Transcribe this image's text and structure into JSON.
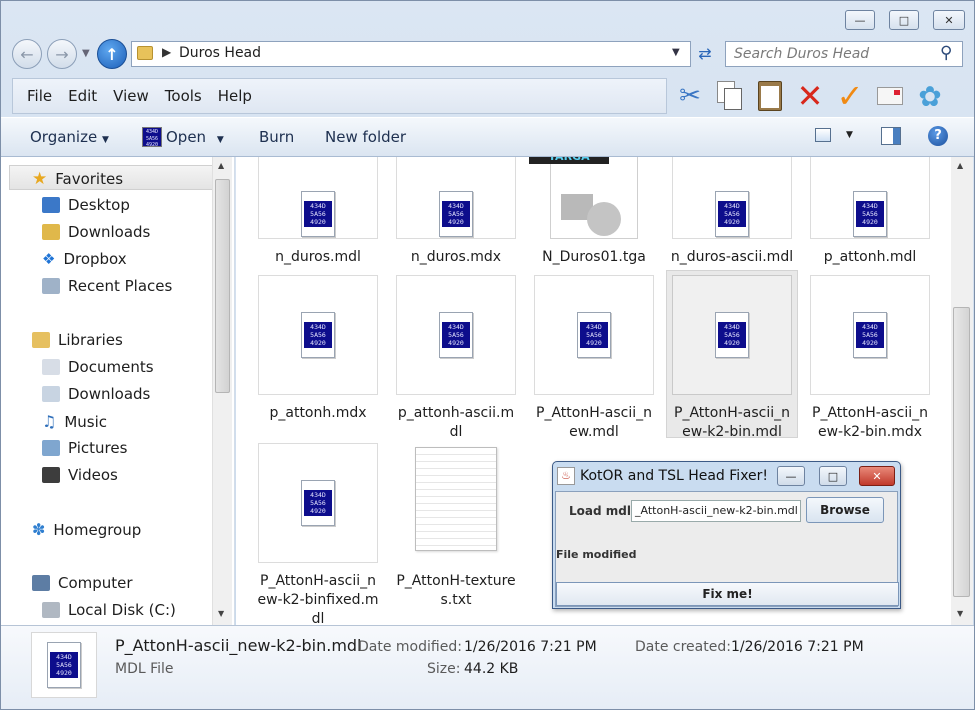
{
  "window": {
    "address_path": "Duros Head",
    "search_placeholder": "Search Duros Head",
    "caption_minimize": "—",
    "caption_maximize": "□",
    "caption_close": "✕"
  },
  "menu": [
    "File",
    "Edit",
    "View",
    "Tools",
    "Help"
  ],
  "toolbar_icons": [
    "scissors-icon",
    "copy-icon",
    "paste-icon",
    "delete-icon",
    "check-icon",
    "mail-icon",
    "shell-icon"
  ],
  "commandbar": {
    "organize": "Organize",
    "open": "Open",
    "burn": "Burn",
    "new_folder": "New folder"
  },
  "nav": {
    "favorites": "Favorites",
    "desktop": "Desktop",
    "downloads": "Downloads",
    "dropbox": "Dropbox",
    "recent": "Recent Places",
    "libraries": "Libraries",
    "documents": "Documents",
    "lib_downloads": "Downloads",
    "music": "Music",
    "pictures": "Pictures",
    "videos": "Videos",
    "homegroup": "Homegroup",
    "computer": "Computer",
    "local_disk": "Local Disk (C:)"
  },
  "files": [
    {
      "name": "n_duros.mdl",
      "type": "mdl"
    },
    {
      "name": "n_duros.mdx",
      "type": "mdl"
    },
    {
      "name": "N_Duros01.tga",
      "type": "tga"
    },
    {
      "name": "n_duros-ascii.mdl",
      "type": "mdl"
    },
    {
      "name": "p_attonh.mdl",
      "type": "mdl"
    },
    {
      "name": "p_attonh.mdx",
      "type": "mdl"
    },
    {
      "name": "p_attonh-ascii.mdl",
      "type": "mdl"
    },
    {
      "name": "P_AttonH-ascii_new.mdl",
      "type": "mdl"
    },
    {
      "name": "P_AttonH-ascii_new-k2-bin.mdl",
      "type": "mdl",
      "selected": true
    },
    {
      "name": "P_AttonH-ascii_new-k2-bin.mdx",
      "type": "mdl"
    },
    {
      "name": "P_AttonH-ascii_new-k2-binfixed.mdl",
      "type": "mdl"
    },
    {
      "name": "P_AttonH-textures.txt",
      "type": "txt"
    }
  ],
  "file_label_lines": [
    [
      "n_duros.mdl"
    ],
    [
      "n_duros.mdx"
    ],
    [
      "N_Duros01.tga"
    ],
    [
      "n_duros-ascii.mdl"
    ],
    [
      "p_attonh.mdl"
    ],
    [
      "p_attonh.mdx"
    ],
    [
      "p_attonh-ascii.m",
      "dl"
    ],
    [
      "P_AttonH-ascii_n",
      "ew.mdl"
    ],
    [
      "P_AttonH-ascii_n",
      "ew-k2-bin.mdl"
    ],
    [
      "P_AttonH-ascii_n",
      "ew-k2-bin.mdx"
    ],
    [
      "P_AttonH-ascii_n",
      "ew-k2-binfixed.m",
      "dl"
    ],
    [
      "P_AttonH-texture",
      "s.txt"
    ]
  ],
  "tga_banner": "TARGA",
  "mdl_glyph": [
    "434D",
    "5A56",
    "4920"
  ],
  "details": {
    "filename": "P_AttonH-ascii_new-k2-bin.mdl",
    "filetype": "MDL File",
    "date_modified_label": "Date modified:",
    "date_modified": "1/26/2016 7:21 PM",
    "date_created_label": "Date created:",
    "date_created": "1/26/2016 7:21 PM",
    "size_label": "Size:",
    "size": "44.2 KB"
  },
  "dialog": {
    "title": "KotOR and TSL Head Fixer!",
    "load_label": "Load mdl:",
    "load_value": "_AttonH-ascii_new-k2-bin.mdl",
    "browse": "Browse",
    "status": "File modified",
    "fix": "Fix me!"
  }
}
